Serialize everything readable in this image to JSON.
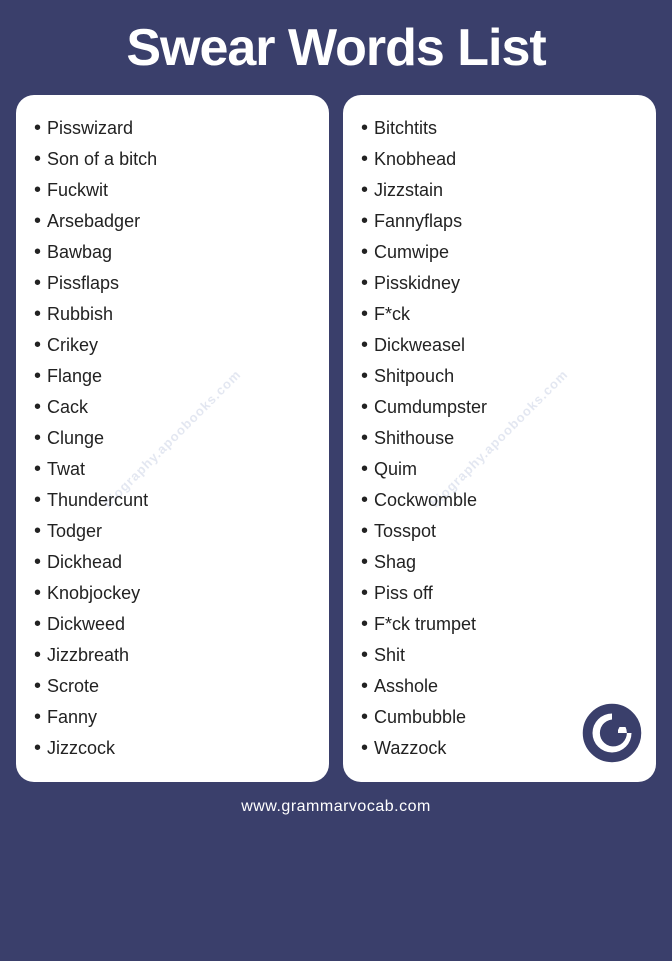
{
  "title": "Swear Words List",
  "left_column": {
    "items": [
      "Pisswizard",
      "Son of a bitch",
      "Fuckwit",
      "Arsebadger",
      "Bawbag",
      "Pissflaps",
      "Rubbish",
      "Crikey",
      "Flange",
      "Cack",
      "Clunge",
      "Twat",
      "Thundercunt",
      "Todger",
      "Dickhead",
      "Knobjockey",
      "Dickweed",
      "Jizzbreath",
      "Scrote",
      "Fanny",
      "Jizzcock"
    ]
  },
  "right_column": {
    "items": [
      "Bitchtits",
      "Knobhead",
      "Jizzstain",
      "Fannyflaps",
      "Cumwipe",
      "Pisskidney",
      "F*ck",
      "Dickweasel",
      "Shitpouch",
      "Cumdumpster",
      "Shithouse",
      "Quim",
      "Cockwomble",
      "Tosspot",
      "Shag",
      "Piss off",
      "F*ck trumpet",
      "Shit",
      "Asshole",
      "Cumbubble",
      "Wazzock"
    ]
  },
  "footer": "www.grammarvocab.com",
  "watermark": "biography.apoobooks.com"
}
